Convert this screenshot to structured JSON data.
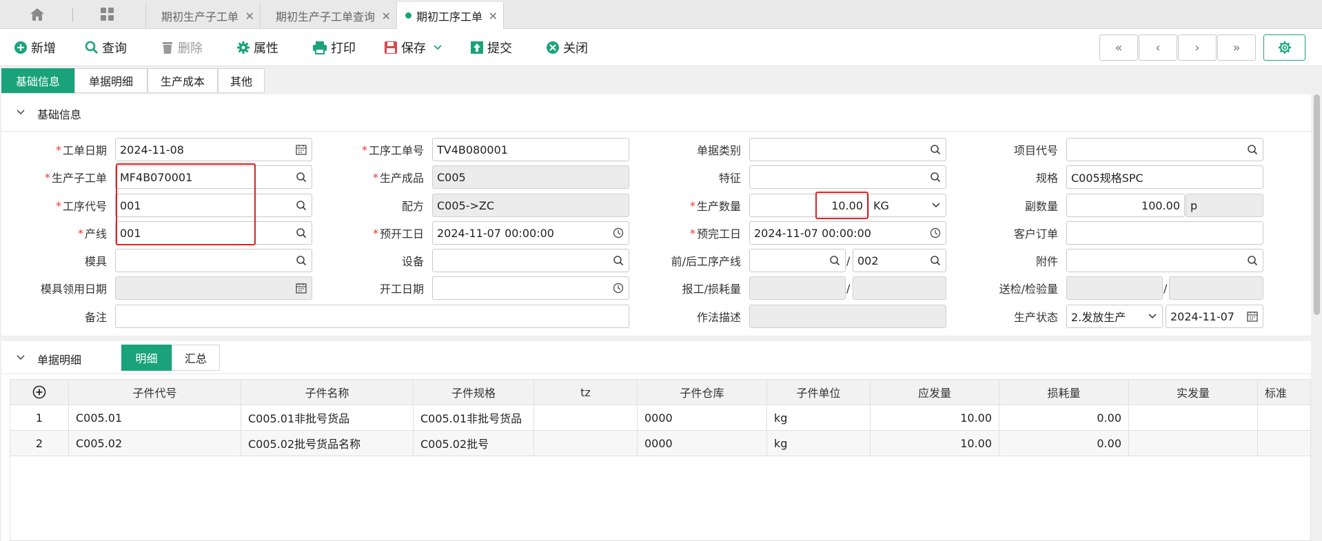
{
  "tabs": [
    {
      "label": "期初生产子工单",
      "active": false
    },
    {
      "label": "期初生产子工单查询",
      "active": false
    },
    {
      "label": "期初工序工单",
      "active": true
    }
  ],
  "toolbar": {
    "new": "新增",
    "query": "查询",
    "delete": "删除",
    "props": "属性",
    "print": "打印",
    "save": "保存",
    "submit": "提交",
    "close": "关闭"
  },
  "section_tabs": [
    "基础信息",
    "单据明细",
    "生产成本",
    "其他"
  ],
  "basic": {
    "title": "基础信息",
    "labels": {
      "work_date": "工单日期",
      "proc_no": "工序工单号",
      "doc_type": "单据类别",
      "project_code": "项目代号",
      "prod_sub": "生产子工单",
      "product": "生产成品",
      "feature": "特征",
      "spec": "规格",
      "proc_code": "工序代号",
      "formula": "配方",
      "qty": "生产数量",
      "sub_qty": "副数量",
      "line": "产线",
      "plan_start": "预开工日",
      "plan_end": "预完工日",
      "cust_order": "客户订单",
      "mold": "模具",
      "equip": "设备",
      "prev_next": "前/后工序产线",
      "attach": "附件",
      "mold_date": "模具领用日期",
      "start_date": "开工日期",
      "report_loss": "报工/损耗量",
      "inspect": "送检/检验量",
      "remark": "备注",
      "method": "作法描述",
      "status": "生产状态"
    },
    "values": {
      "work_date": "2024-11-08",
      "proc_no": "TV4B080001",
      "doc_type": "",
      "project_code": "",
      "prod_sub": "MF4B070001",
      "product": "C005",
      "feature": "",
      "spec": "C005规格SPC",
      "proc_code": "001",
      "formula": "C005->ZC",
      "qty": "10.00",
      "unit": "KG",
      "sub_qty": "100.00",
      "sub_unit": "p",
      "line": "001",
      "plan_start": "2024-11-07 00:00:00",
      "plan_end": "2024-11-07 00:00:00",
      "cust_order": "",
      "mold": "",
      "equip": "",
      "prev_line": "",
      "next_line": "002",
      "attach": "",
      "mold_date": "",
      "start_date": "",
      "report": "",
      "loss": "",
      "inspect_send": "",
      "inspect_done": "",
      "remark": "",
      "method": "",
      "status": "2.发放生产",
      "status_date": "2024-11-07"
    },
    "slash": "/"
  },
  "detail": {
    "title": "单据明细",
    "subtabs": [
      "明细",
      "汇总"
    ],
    "columns": [
      "子件代号",
      "子件名称",
      "子件规格",
      "tz",
      "子件仓库",
      "子件单位",
      "应发量",
      "损耗量",
      "实发量",
      "标准"
    ],
    "rows": [
      {
        "no": "1",
        "code": "C005.01",
        "name": "C005.01非批号货品",
        "spec": "C005.01非批号货品",
        "tz": "",
        "wh": "0000",
        "unit": "kg",
        "due": "10.00",
        "loss": "0.00",
        "actual": ""
      },
      {
        "no": "2",
        "code": "C005.02",
        "name": "C005.02批号货品名称",
        "spec": "C005.02批号",
        "tz": "",
        "wh": "0000",
        "unit": "kg",
        "due": "10.00",
        "loss": "0.00",
        "actual": ""
      }
    ]
  },
  "colors": {
    "accent": "#1aa37a",
    "highlight": "#e02020"
  }
}
